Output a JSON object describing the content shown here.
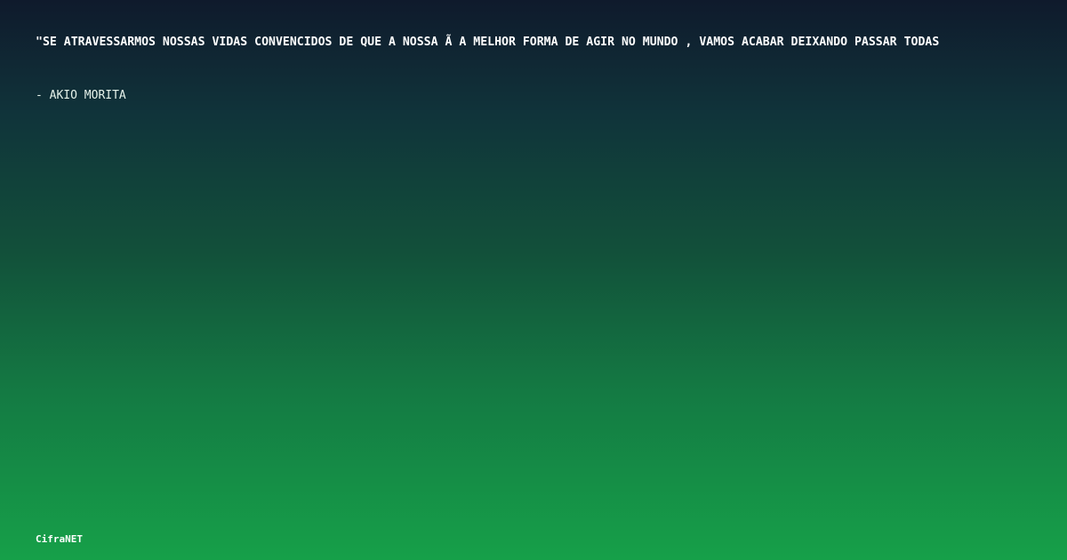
{
  "quote": {
    "text": "\"SE ATRAVESSARMOS NOSSAS VIDAS CONVENCIDOS DE QUE A NOSSA Ã  A MELHOR FORMA DE AGIR NO MUNDO , VAMOS ACABAR DEIXANDO PASSAR TODAS"
  },
  "author": {
    "text": "- AKIO MORITA"
  },
  "brand": {
    "name": "CifraNET"
  },
  "colors": {
    "gradient_top": "#0f1a2c",
    "gradient_bottom": "#16a049",
    "text": "#ffffff"
  }
}
